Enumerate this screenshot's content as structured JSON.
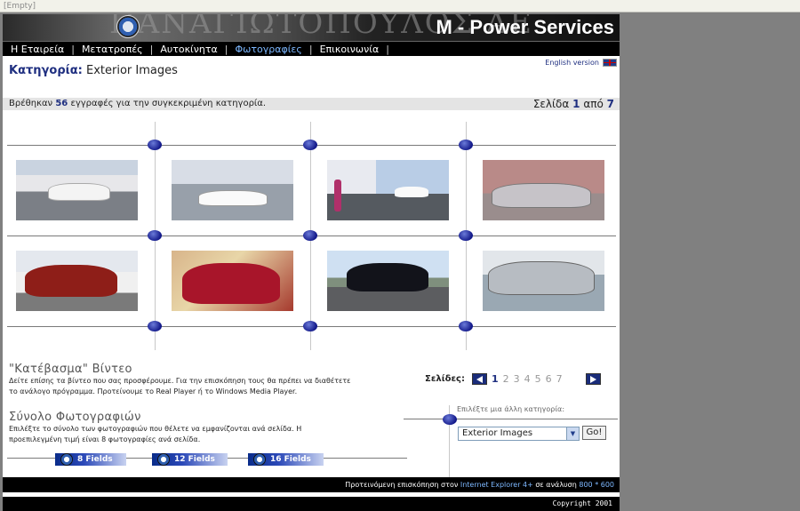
{
  "window": {
    "title": "[Empty]"
  },
  "banner": {
    "background_text": "ΠΑΝΑΓΙΩΤΟΠΟΥΛΟΣ ΑΕ",
    "brand": "M - Power Services"
  },
  "nav": {
    "items": [
      {
        "label": "Η Εταιρεία",
        "active": false
      },
      {
        "label": "Μετατροπές",
        "active": false
      },
      {
        "label": "Αυτοκίνητα",
        "active": false
      },
      {
        "label": "Φωτογραφίες",
        "active": true
      },
      {
        "label": "Επικοινωνία",
        "active": false
      }
    ],
    "separator": "|"
  },
  "lang": {
    "label": "English version"
  },
  "category": {
    "label": "Κατηγορία:",
    "value": "Exterior Images"
  },
  "results": {
    "prefix": "Βρέθηκαν",
    "count": "56",
    "suffix": "εγγραφές για την συγκεκριμένη κατηγορία.",
    "page_label": "Σελίδα",
    "page_current": "1",
    "page_of": "από",
    "page_total": "7"
  },
  "photos": [
    {
      "name": "photo-1"
    },
    {
      "name": "photo-2"
    },
    {
      "name": "photo-3"
    },
    {
      "name": "photo-4"
    },
    {
      "name": "photo-5"
    },
    {
      "name": "photo-6"
    },
    {
      "name": "photo-7"
    },
    {
      "name": "photo-8"
    }
  ],
  "download": {
    "title": "\"Κατέβασμα\" Βίντεο",
    "text": "Δείτε επίσης τα βίντεο που σας προσφέρουμε. Για την επισκόπηση τους θα πρέπει να διαθέτετε το ανάλογο πρόγραμμα. Προτείνουμε το Real Player ή το Windows Media Player."
  },
  "pagination": {
    "label": "Σελίδες:",
    "pages": [
      "1",
      "2",
      "3",
      "4",
      "5",
      "6",
      "7"
    ],
    "current": "1"
  },
  "photo_count": {
    "title": "Σύνολο Φωτογραφιών",
    "text": "Επιλέξτε το σύνολο των φωτογραφιών που θέλετε να εμφανίζονται ανά σελίδα. Η προεπιλεγμένη τιμή είναι 8 φωτογραφίες ανά σελίδα."
  },
  "category_select": {
    "label": "Επιλέξτε μια άλλη κατηγορία:",
    "selected": "Exterior Images",
    "go": "Go!"
  },
  "field_buttons": [
    "8 Fields",
    "12 Fields",
    "16 Fields"
  ],
  "footer": {
    "prefix": "Προτεινόμενη επισκόπηση στον",
    "browser": "Internet Explorer 4+",
    "middle": "σε ανάλυση",
    "resolution": "800 * 600",
    "copyright": "Copyright 2001"
  },
  "colors": {
    "accent": "#1f2f80",
    "link": "#7db8ff",
    "bar": "#000000"
  }
}
